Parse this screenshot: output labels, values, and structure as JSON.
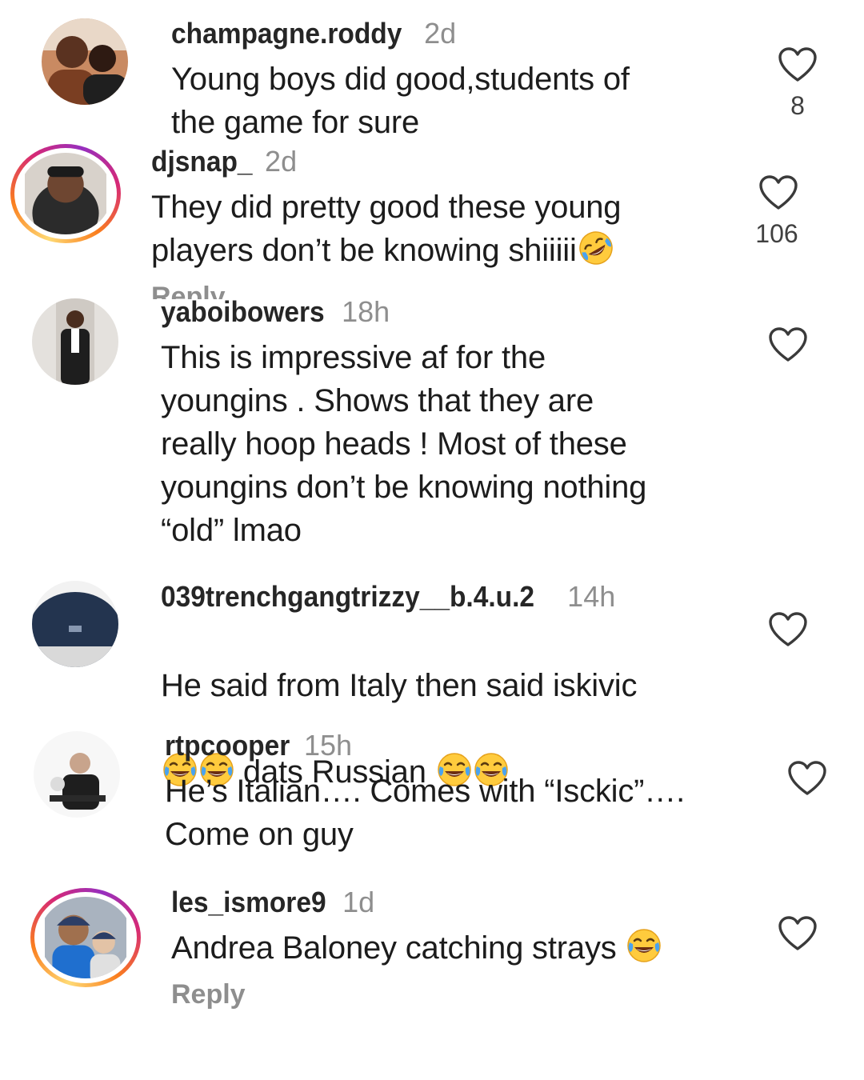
{
  "comments": [
    {
      "username": "champagne.roddy",
      "time": "2d",
      "text": "Young boys did good,students of\nthe game for sure",
      "likes": "8",
      "avatar_icon": "two-men-photo",
      "story_ring": false
    },
    {
      "username": "djsnap_",
      "time": "2d",
      "text": "They did pretty good these young\nplayers don’t be knowing shiiiii",
      "emoji": "rolling-on-floor-laughing",
      "likes": "106",
      "reply_label": "Reply",
      "avatar_icon": "man-in-hoodie-photo",
      "story_ring": true
    },
    {
      "username": "yaboibowers",
      "time": "18h",
      "text": "This is impressive af for the\nyoungins . Shows that they are\nreally hoop heads ! Most of these\nyoungins don’t be knowing nothing\n“old” lmao",
      "avatar_icon": "man-in-tuxedo-photo",
      "story_ring": false
    },
    {
      "username": "039trenchgangtrizzy__b.4.u.2",
      "time": "14h",
      "text_line1": "He said from Italy then said iskivic",
      "text_line2": "dats Russian",
      "emoji": "face-with-tears-of-joy",
      "avatar_icon": "navy-cap-photo",
      "story_ring": false
    },
    {
      "username": "rtpcooper",
      "time": "15h",
      "text": "He’s Italian…. Comes with “Isckic”….\nCome on guy",
      "avatar_icon": "man-in-black-shirt-photo",
      "story_ring": false
    },
    {
      "username": "les_ismore9",
      "time": "1d",
      "text": "Andrea Baloney catching strays",
      "emoji": "face-with-tears-of-joy",
      "reply_label": "Reply",
      "avatar_icon": "two-people-in-caps-photo",
      "story_ring": true
    }
  ],
  "colors": {
    "username": "#262626",
    "timestamp": "#8e8e8e",
    "text": "#1c1c1c",
    "heart_stroke": "#3a3a3a",
    "story_ring": [
      "#feda75",
      "#fa7e1e",
      "#d62976",
      "#962fbf"
    ]
  }
}
